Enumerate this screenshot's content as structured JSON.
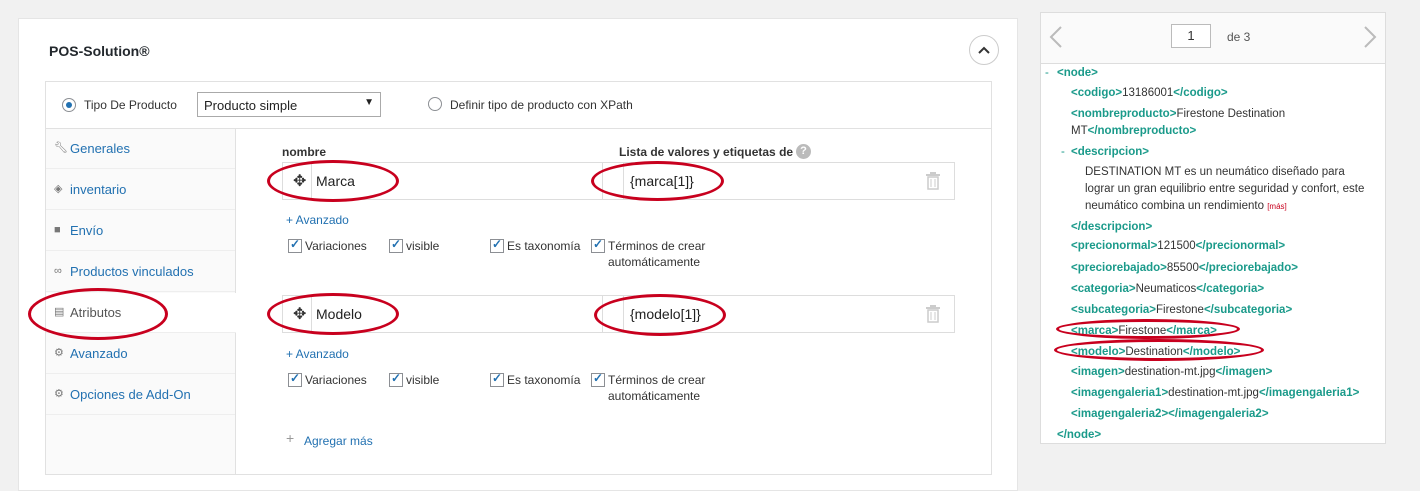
{
  "panel": {
    "title": "POS-Solution®"
  },
  "type_bar": {
    "option1_label": "Tipo De Producto",
    "select_value": "Producto simple",
    "option2_label": "Definir tipo de producto con XPath"
  },
  "sidebar": {
    "items": [
      {
        "label": "Generales",
        "icon": "wrench-icon"
      },
      {
        "label": "inventario",
        "icon": "tag-icon"
      },
      {
        "label": "Envío",
        "icon": "truck-icon"
      },
      {
        "label": "Productos vinculados",
        "icon": "link-icon"
      },
      {
        "label": "Atributos",
        "icon": "list-icon"
      },
      {
        "label": "Avanzado",
        "icon": "gear-icon"
      },
      {
        "label": "Opciones de Add-On",
        "icon": "gear-icon"
      }
    ]
  },
  "attributes": {
    "name_header": "nombre",
    "values_header": "Lista de valores y etiquetas de",
    "advanced_link": "+ Avanzado",
    "add_more": "Agregar más",
    "rows": [
      {
        "name": "Marca",
        "value": "{marca[1]}"
      },
      {
        "name": "Modelo",
        "value": "{modelo[1]}"
      }
    ],
    "checkboxes": {
      "variations": "Variaciones",
      "visible": "visible",
      "taxonomy": "Es taxonomía",
      "terms_line1": "Términos de crear",
      "terms_line2": "automáticamente"
    }
  },
  "xml_viewer": {
    "page": "1",
    "of_label": "de 3",
    "more_label": "[más]",
    "lines": {
      "node_open": "<node>",
      "codigo": "<codigo>13186001</codigo>",
      "nombre_1": "<nombreproducto>Firestone Destination",
      "nombre_2": "MT</nombreproducto>",
      "desc_open": "<descripcion>",
      "desc_1": "DESTINATION MT es un neumático diseñado para",
      "desc_2": "lograr un gran equilibrio entre seguridad y confort, este",
      "desc_3": "neumático combina un rendimiento",
      "desc_close": "</descripcion>",
      "precionormal": "<precionormal>121500</precionormal>",
      "preciorebajado": "<preciorebajado>85500</preciorebajado>",
      "categoria": "<categoria>Neumaticos</categoria>",
      "subcategoria": "<subcategoria>Firestone</subcategoria>",
      "marca": "<marca>Firestone</marca>",
      "modelo": "<modelo>Destination</modelo>",
      "imagen": "<imagen>destination-mt.jpg</imagen>",
      "imagengaleria1": "<imagengaleria1>destination-mt.jpg</imagengaleria1>",
      "imagengaleria2": "<imagengaleria2></imagengaleria2>",
      "node_close": "</node>"
    },
    "toggles": {
      "node": "-",
      "desc": "-"
    }
  },
  "colors": {
    "accent": "#2271b1",
    "xml_tag": "#1a9a8a",
    "annotation": "#c8001e"
  }
}
